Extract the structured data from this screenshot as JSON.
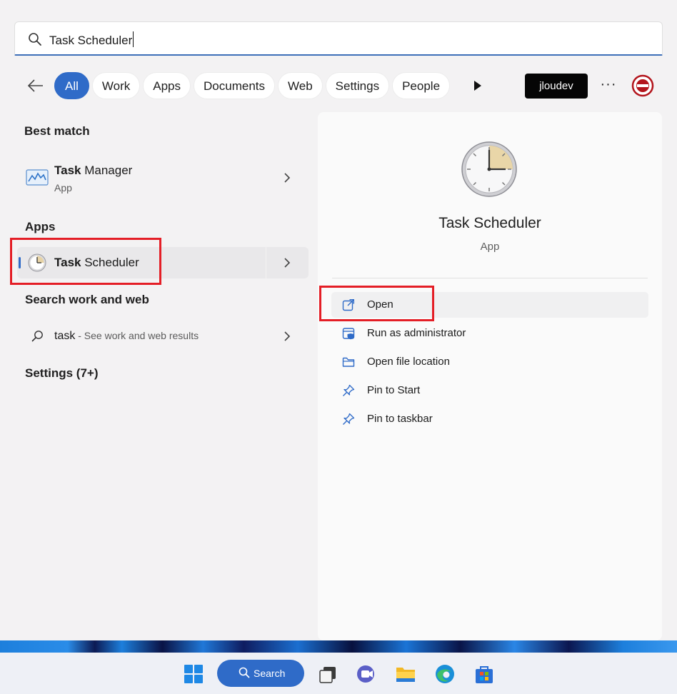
{
  "search": {
    "query": "Task Scheduler"
  },
  "filters": {
    "chips": [
      "All",
      "Work",
      "Apps",
      "Documents",
      "Web",
      "Settings",
      "People"
    ],
    "active": "All",
    "user": "jloudev"
  },
  "results": {
    "best_match_heading": "Best match",
    "best_match": {
      "title_bold": "Task",
      "title_rest": " Manager",
      "subtitle": "App"
    },
    "apps_heading": "Apps",
    "apps_item": {
      "title_bold": "Task",
      "title_rest": " Scheduler"
    },
    "web_heading": "Search work and web",
    "web_item": {
      "query": "task",
      "hint": " - See work and web results"
    },
    "settings_heading": "Settings (7+)"
  },
  "preview": {
    "title": "Task Scheduler",
    "subtitle": "App",
    "actions": [
      {
        "label": "Open",
        "icon": "open-external-icon"
      },
      {
        "label": "Run as administrator",
        "icon": "shield-admin-icon"
      },
      {
        "label": "Open file location",
        "icon": "folder-icon"
      },
      {
        "label": "Pin to Start",
        "icon": "pin-icon"
      },
      {
        "label": "Pin to taskbar",
        "icon": "pin-icon"
      }
    ]
  },
  "taskbar": {
    "search_label": "Search",
    "apps": [
      "windows-start-icon",
      "task-view-icon",
      "meet-icon",
      "file-explorer-icon",
      "edge-icon",
      "store-icon"
    ]
  },
  "colors": {
    "accent": "#2f6bc8",
    "highlight_box": "#e41e26"
  }
}
